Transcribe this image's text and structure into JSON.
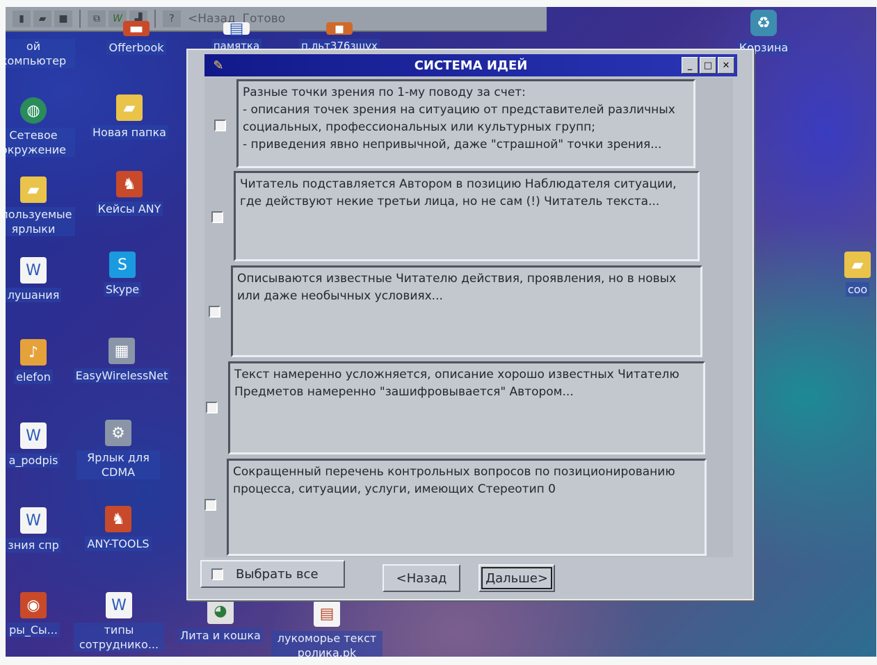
{
  "toolbar": {
    "back": "<Назад",
    "done": "Готово"
  },
  "desktop": {
    "icons": [
      {
        "label": "ой компьютер"
      },
      {
        "label": "Offerbook"
      },
      {
        "label": "памятка"
      },
      {
        "label": "п.льт376зшух"
      },
      {
        "label": "Корзина"
      },
      {
        "label": "Сетевое окружение"
      },
      {
        "label": "Новая папка"
      },
      {
        "label": "спользуемые ярлыки"
      },
      {
        "label": "Кейсы ANY"
      },
      {
        "label": "лушания"
      },
      {
        "label": "Skype"
      },
      {
        "label": "соо"
      },
      {
        "label": "elefon"
      },
      {
        "label": "EasyWirelessNet"
      },
      {
        "label": "a_podpis"
      },
      {
        "label": "Ярлык для CDMA"
      },
      {
        "label": "зния спр"
      },
      {
        "label": "ANY-TOOLS"
      },
      {
        "label": "ры_Сы..."
      },
      {
        "label": "типы сотруднико..."
      },
      {
        "label": "Лита и кошка"
      },
      {
        "label": "лукоморье текст ролика.pk"
      }
    ]
  },
  "window": {
    "title": "СИСТЕМА ИДЕЙ",
    "ideas": [
      {
        "text": "Разные точки зрения по 1-му поводу за счет:\n- описания точек зрения на ситуацию от представителей различных социальных, профессиональных или культурных групп;\n- приведения явно непривычной, даже \"страшной\" точки зрения..."
      },
      {
        "text": "Читатель подставляется Автором в позицию Наблюдателя ситуации, где действуют некие третьи лица, но не сам (!) Читатель текста..."
      },
      {
        "text": "Описываются известные Читателю действия, проявления, но в новых или даже необычных условиях..."
      },
      {
        "text": "Текст намеренно усложняется, описание хорошо известных Читателю Предметов намеренно \"зашифровывается\" Автором..."
      },
      {
        "text": "Сокращенный перечень контрольных вопросов по позиционированию процесса, ситуации, услуги, имеющих Стереотип 0"
      }
    ],
    "select_all": "Выбрать все",
    "back": "<Назад",
    "next": "Дальше>"
  }
}
